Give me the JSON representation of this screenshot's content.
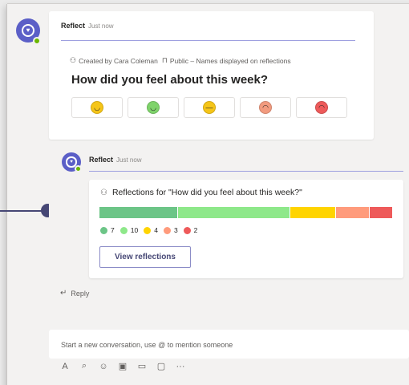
{
  "message1": {
    "sender": "Reflect",
    "time": "Just now",
    "created_by": "Created by Cara Coleman",
    "visibility": "Public – Names displayed on reflections",
    "question": "How did you feel about this week?",
    "emoji_icons": [
      "very-happy-face-icon",
      "happy-face-icon",
      "neutral-face-icon",
      "sad-face-icon",
      "very-sad-face-icon"
    ],
    "emoji_colors": [
      "#f5c518",
      "#7fd36b",
      "#f5c518",
      "#f29b7f",
      "#ee5a5a"
    ]
  },
  "message2": {
    "sender": "Reflect",
    "time": "Just now",
    "title": "Reflections for \"How did you feel about this week?\"",
    "bar": {
      "counts": [
        7,
        10,
        4,
        3,
        2
      ],
      "colors": [
        "#6cc587",
        "#8ee88a",
        "#ffd400",
        "#ff9b7c",
        "#ee5a5a"
      ]
    },
    "legend": [
      {
        "label": "7",
        "color": "#6cc587"
      },
      {
        "label": "10",
        "color": "#8ee88a"
      },
      {
        "label": "4",
        "color": "#ffd400"
      },
      {
        "label": "3",
        "color": "#ff9b7c"
      },
      {
        "label": "2",
        "color": "#ee5a5a"
      }
    ],
    "button_label": "View reflections"
  },
  "reply_label": "Reply",
  "compose_placeholder": "Start a new conversation, use @ to mention someone",
  "toolbar_icons": [
    "format-icon",
    "attach-icon",
    "emoji-icon",
    "gif-icon",
    "sticker-icon",
    "meet-icon",
    "more-icon"
  ],
  "toolbar_glyphs": [
    "A",
    "⌕",
    "☺",
    "▣",
    "▭",
    "▢",
    "···"
  ]
}
